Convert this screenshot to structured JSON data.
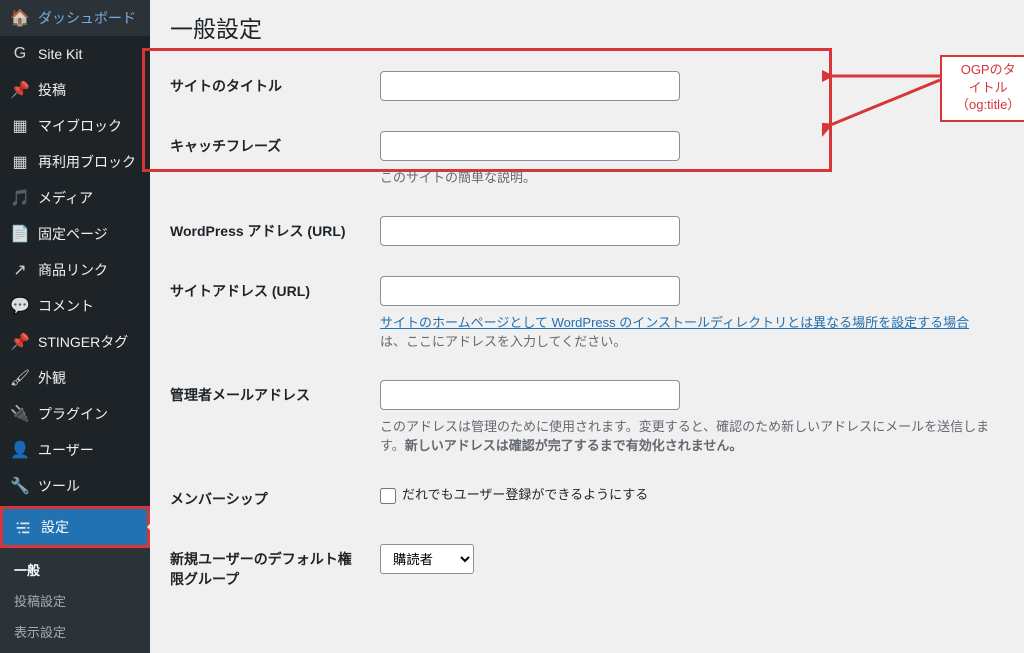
{
  "annotation": {
    "label_line1": "OGPのタイトル",
    "label_line2": "（og:title）"
  },
  "page_title": "一般設定",
  "nav": {
    "dashboard": "ダッシュボード",
    "sitekit": "Site Kit",
    "posts": "投稿",
    "myblock": "マイブロック",
    "reusable": "再利用ブロック",
    "media": "メディア",
    "pages": "固定ページ",
    "product": "商品リンク",
    "comments": "コメント",
    "stinger": "STINGERタグ",
    "appearance": "外観",
    "plugins": "プラグイン",
    "users": "ユーザー",
    "tools": "ツール",
    "settings": "設定"
  },
  "submenu": {
    "general": "一般",
    "writing": "投稿設定",
    "reading": "表示設定"
  },
  "fields": {
    "site_title": {
      "label": "サイトのタイトル",
      "value": ""
    },
    "tagline": {
      "label": "キャッチフレーズ",
      "value": "",
      "desc": "このサイトの簡単な説明。"
    },
    "wpurl": {
      "label": "WordPress アドレス (URL)",
      "value": ""
    },
    "siteurl": {
      "label": "サイトアドレス (URL)",
      "value": "",
      "link_text": "サイトのホームページとして WordPress のインストールディレクトリとは異なる場所を設定する場合",
      "desc_after": "は、ここにアドレスを入力してください。"
    },
    "admin_email": {
      "label": "管理者メールアドレス",
      "value": "",
      "desc_a": "このアドレスは管理のために使用されます。変更すると、確認のため新しいアドレスにメールを送信します。",
      "desc_b": "新しいアドレスは確認が完了するまで有効化されません。"
    },
    "membership": {
      "label": "メンバーシップ",
      "checkbox_label": "だれでもユーザー登録ができるようにする"
    },
    "default_role": {
      "label": "新規ユーザーのデフォルト権限グループ",
      "options": [
        "購読者"
      ],
      "selected": "購読者"
    }
  }
}
